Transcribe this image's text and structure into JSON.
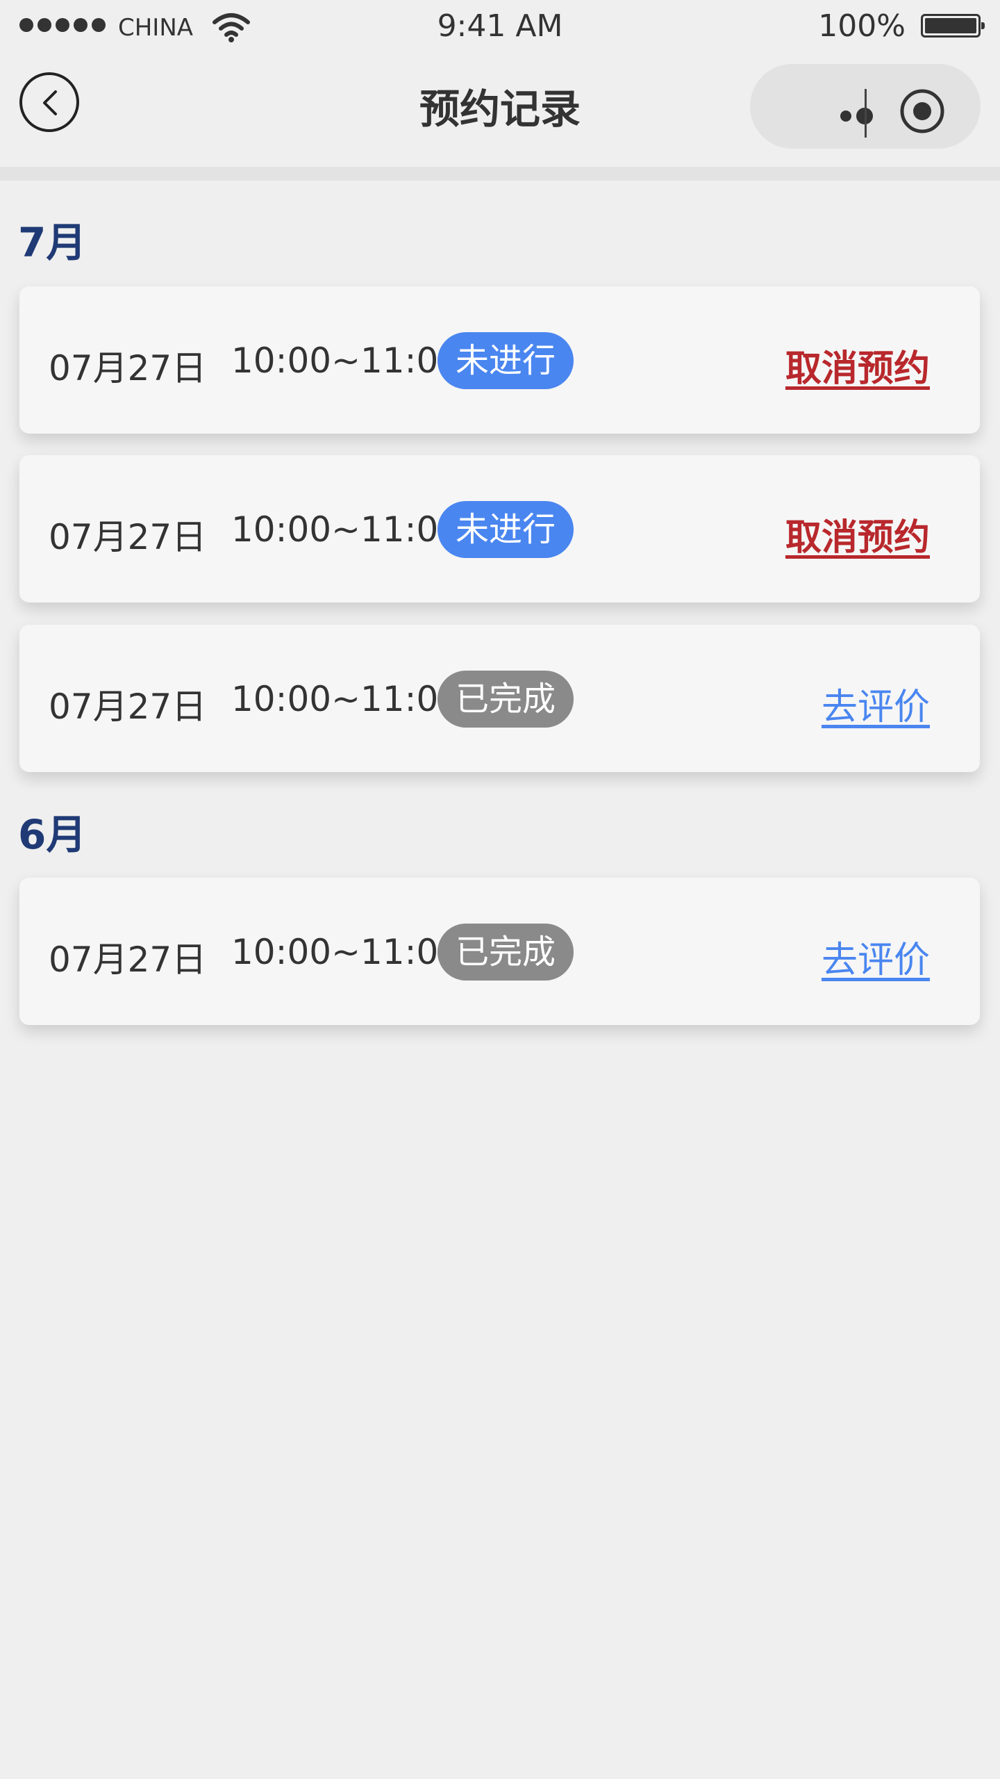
{
  "status_bar": {
    "carrier": "CHINA",
    "time": "9:41 AM",
    "battery_percent": "100%"
  },
  "nav": {
    "title": "预约记录"
  },
  "colors": {
    "month_title": "#1f3a75",
    "pending_badge": "#4a86f0",
    "done_badge": "#8a8a8a",
    "cancel_link": "#b8282c",
    "review_link": "#4a86f0"
  },
  "groups": [
    {
      "month": "7月",
      "records": [
        {
          "date": "07月27日",
          "time": "10:00~11:00",
          "status": "未进行",
          "action": "取消预约"
        },
        {
          "date": "07月27日",
          "time": "10:00~11:00",
          "status": "未进行",
          "action": "取消预约"
        },
        {
          "date": "07月27日",
          "time": "10:00~11:00",
          "status": "已完成",
          "action": "去评价"
        }
      ]
    },
    {
      "month": "6月",
      "records": [
        {
          "date": "07月27日",
          "time": "10:00~11:00",
          "status": "已完成",
          "action": "去评价"
        }
      ]
    }
  ]
}
